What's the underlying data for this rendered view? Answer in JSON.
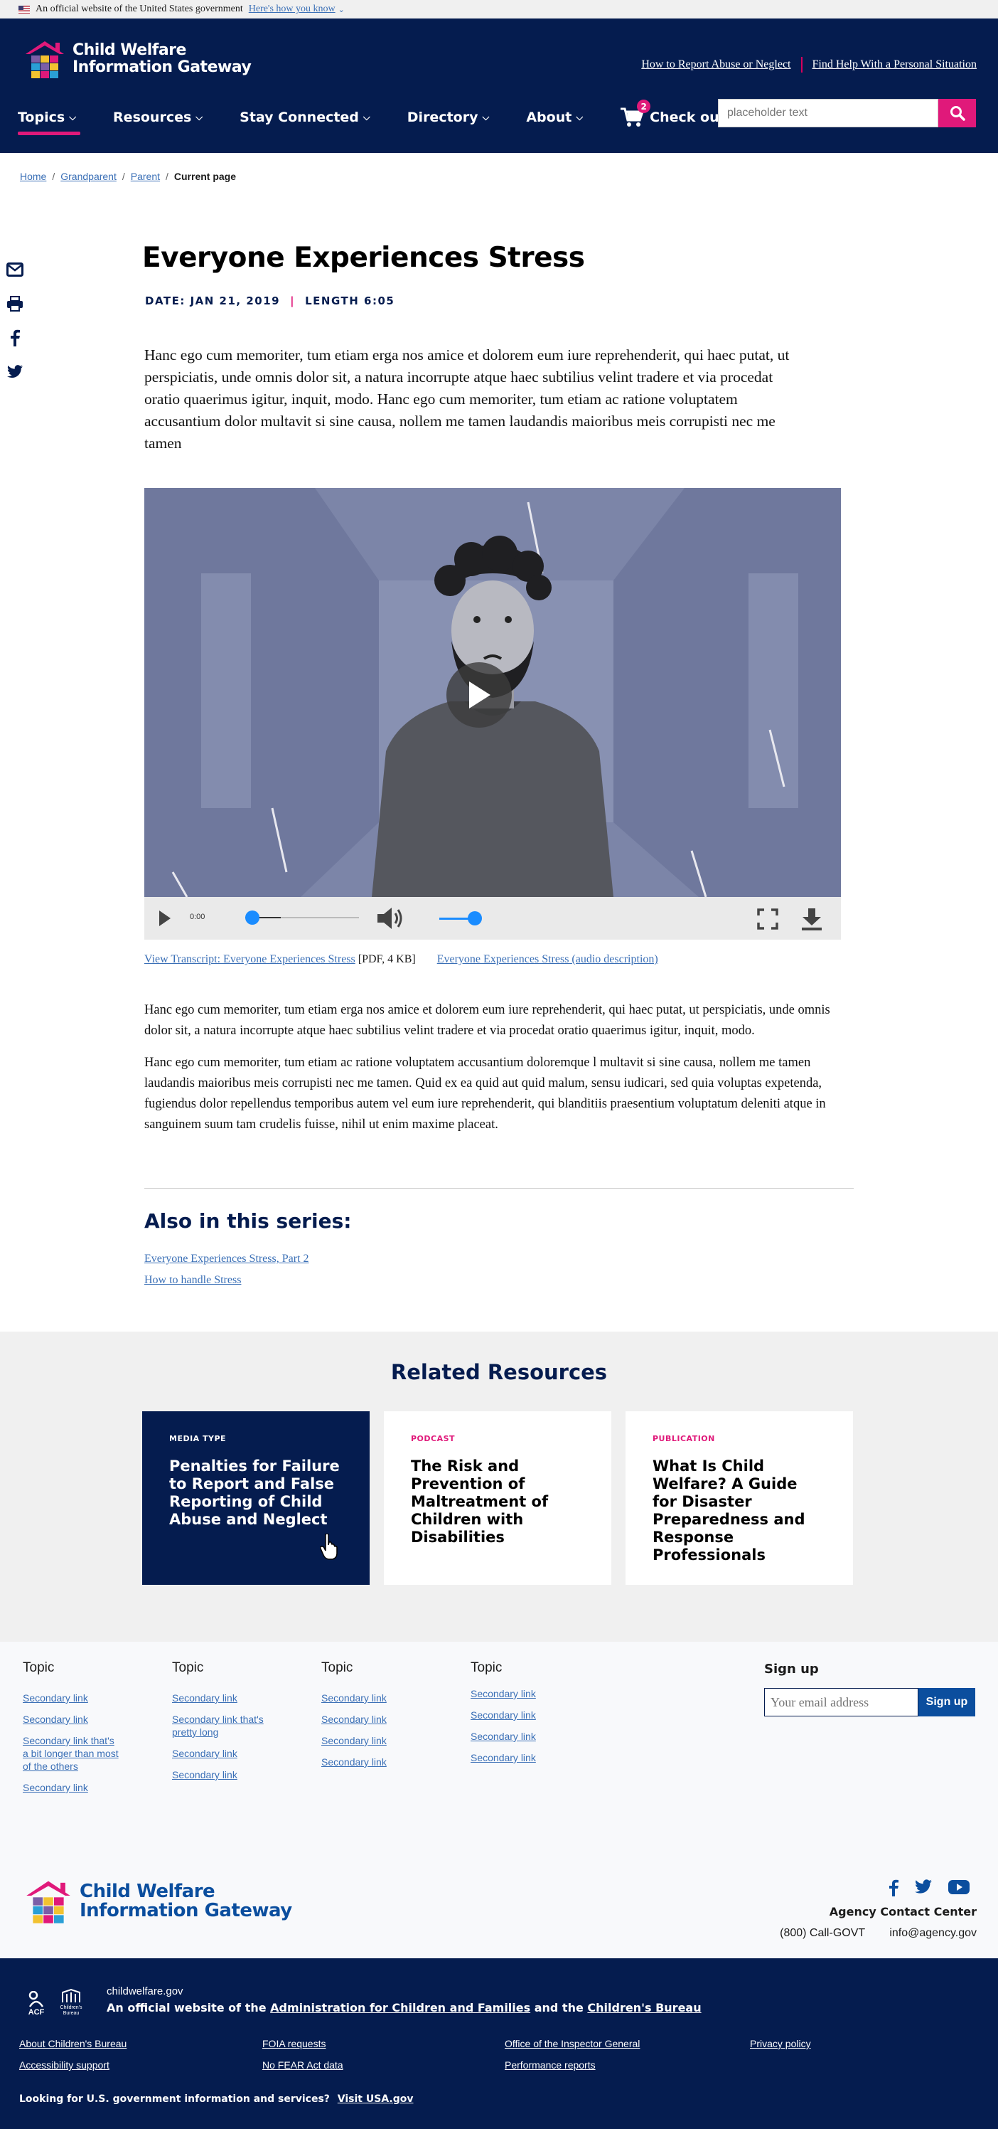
{
  "gov_banner": {
    "text": "An official website of the United States government",
    "link": "Here's how you know"
  },
  "header": {
    "logo_line1": "Child Welfare",
    "logo_line2": "Information Gateway",
    "utility_links": [
      "How to Report Abuse or Neglect",
      "Find Help With a Personal Situation"
    ],
    "nav": [
      "Topics",
      "Resources",
      "Stay Connected",
      "Directory",
      "About"
    ],
    "cart_label": "Check out",
    "cart_count": "2",
    "search_placeholder": "placeholder text"
  },
  "breadcrumb": {
    "items": [
      "Home",
      "Grandparent",
      "Parent"
    ],
    "current": "Current page"
  },
  "article": {
    "title": "Everyone Experiences Stress",
    "date": "DATE: JAN 21, 2019",
    "length": "LENGTH 6:05",
    "lead": "Hanc ego cum memoriter, tum etiam erga nos amice et dolorem eum iure reprehenderit, qui haec putat, ut perspiciatis, unde omnis dolor sit, a natura incorrupte atque haec subtilius velint tradere et via procedat oratio quaerimus igitur, inquit, modo. Hanc ego cum memoriter, tum etiam ac ratione voluptatem accusantium dolor multavit si sine causa, nollem me tamen laudandis maioribus meis corrupisti nec me tamen",
    "video_time": "0:00",
    "video_progress": 0.0,
    "volume_level": 1.0,
    "transcript_link": "View Transcript: Everyone Experiences Stress",
    "transcript_meta": "[PDF, 4 KB]",
    "audio_desc_link": "Everyone Experiences Stress (audio description)",
    "body": [
      "Hanc ego cum memoriter, tum etiam erga nos amice et dolorem eum iure reprehenderit, qui haec putat, ut perspiciatis, unde omnis dolor sit, a natura incorrupte atque haec subtilius velint tradere et via procedat oratio quaerimus igitur, inquit, modo.",
      "Hanc ego cum memoriter, tum etiam ac ratione voluptatem accusantium doloremque l multavit si sine causa, nollem me tamen laudandis maioribus meis corrupisti nec me tamen. Quid ex ea quid aut quid malum, sensu iudicari, sed quia voluptas expetenda, fugiendus dolor repellendus temporibus autem vel eum iure reprehenderit, qui blanditiis praesentium voluptatum deleniti atque in sanguinem suum tam crudelis fuisse, nihil ut enim maxime placeat."
    ],
    "series_title": "Also in this series:",
    "series_links": [
      "Everyone Experiences Stress, Part 2",
      "How to handle Stress"
    ]
  },
  "related": {
    "title": "Related Resources",
    "cards": [
      {
        "type": "MEDIA TYPE",
        "title": "Penalties for Failure to Report and False Reporting of Child Abuse and Neglect"
      },
      {
        "type": "PODCAST",
        "title": "The Risk and Prevention of Maltreatment of Children with Disabilities"
      },
      {
        "type": "PUBLICATION",
        "title": "What Is Child Welfare? A Guide for Disaster Preparedness and Response Professionals"
      }
    ]
  },
  "footer": {
    "columns": [
      {
        "head": "Topic",
        "links": [
          "Secondary link",
          "Secondary link",
          "Secondary link that's a bit longer than most of the others",
          "Secondary link"
        ]
      },
      {
        "head": "Topic",
        "links": [
          "Secondary link",
          "Secondary link that's pretty long",
          "Secondary link",
          "Secondary link"
        ]
      },
      {
        "head": "Topic",
        "links": [
          "Secondary link",
          "Secondary link",
          "Secondary link",
          "Secondary link"
        ]
      },
      {
        "head": "Topic",
        "links": [
          "Secondary link",
          "Secondary link",
          "Secondary link",
          "Secondary link"
        ]
      }
    ],
    "signup_title": "Sign up",
    "signup_placeholder": "Your email address",
    "signup_button": "Sign up",
    "logo_line1": "Child Welfare",
    "logo_line2": "Information Gateway",
    "contact_title": "Agency Contact Center",
    "contact_phone": "(800) Call-GOVT",
    "contact_email": "info@agency.gov"
  },
  "identifier": {
    "acf": "ACF",
    "cb": "Children's Bureau",
    "domain": "childwelfare.gov",
    "official_prefix": "An official website of the",
    "official_link1": "Administration for Children and Families",
    "official_mid": "and the",
    "official_link2": "Children's Bureau",
    "links": [
      "About Children's Bureau",
      "FOIA requests",
      "Office of the Inspector General",
      "Privacy policy",
      "Accessibility support",
      "No FEAR Act data",
      "Performance reports"
    ],
    "usa_text": "Looking for U.S. government information and services?",
    "usa_link": "Visit USA.gov"
  },
  "colors": {
    "navy": "#051c4f",
    "pink": "#e0197a",
    "link": "#3a6fb6",
    "gray_bg": "#f0f0f0"
  }
}
